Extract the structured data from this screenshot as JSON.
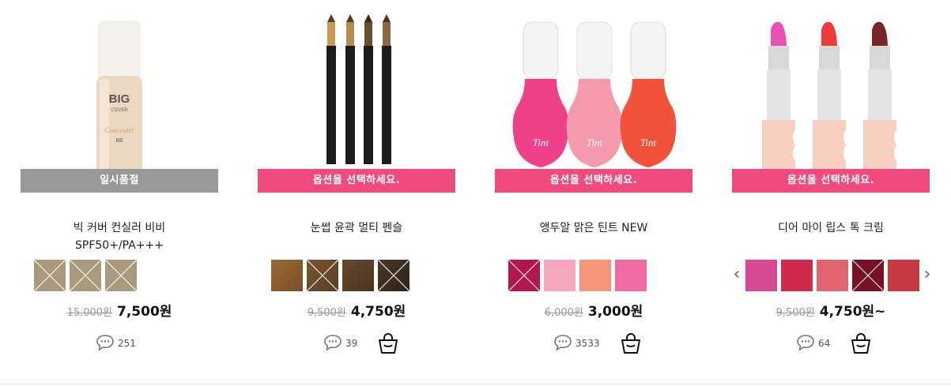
{
  "products": [
    {
      "status": "일시품절",
      "name": "빅 커버 컨실러 비비",
      "name2": "SPF50+/PA+++",
      "orig_price": "15,000원",
      "sale_price": "7,500원",
      "reviews": "251",
      "swatch_colors": [
        "#a99a7d",
        "#a99a7d",
        "#a99a7d"
      ],
      "swatch_soldout": [
        true,
        true,
        true
      ]
    },
    {
      "status": "옵션을 선택하세요.",
      "name": "눈썹 윤곽 멀티 펜슬",
      "orig_price": "9,500원",
      "sale_price": "4,750원",
      "reviews": "39",
      "swatch_colors": [
        "#8a5e2e",
        "#6b4a2a",
        "#5a4025",
        "#3a2c1e"
      ],
      "swatch_soldout": [
        false,
        true,
        false,
        true
      ]
    },
    {
      "status": "옵션을 선택하세요.",
      "name": "앵두알 맑은 틴트 NEW",
      "orig_price": "6,000원",
      "sale_price": "3,000원",
      "reviews": "3533",
      "swatch_colors": [
        "#b3164f",
        "#f6a6bd",
        "#f7947a",
        "#f06aa4"
      ],
      "swatch_soldout": [
        true,
        false,
        false,
        false
      ]
    },
    {
      "status": "옵션을 선택하세요.",
      "name": "디어 마이 립스 톡 크림",
      "orig_price": "9,500원",
      "sale_price": "4,750원~",
      "reviews": "64",
      "swatch_colors": [
        "#d94a95",
        "#cf2a4c",
        "#e06370",
        "#7a1026",
        "#c83a42"
      ],
      "swatch_soldout": [
        false,
        false,
        false,
        true,
        false
      ]
    }
  ],
  "colors": {
    "accent": "#f04b7e",
    "soldout_bar": "#999999"
  },
  "icons": {
    "review": "speech-bubble-icon",
    "cart": "shopping-bag-icon",
    "prev": "chevron-left-icon",
    "next": "chevron-right-icon"
  }
}
